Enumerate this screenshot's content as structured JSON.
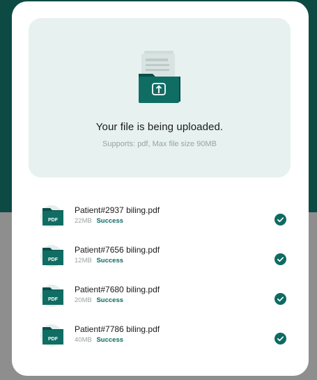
{
  "upload": {
    "title": "Your file is being uploaded.",
    "subtitle": "Supports: pdf, Max file size 90MB",
    "icon": "folder-upload-icon"
  },
  "files": [
    {
      "name": "Patient#2937 biling.pdf",
      "size": "22MB",
      "status": "Success",
      "badge": "PDF"
    },
    {
      "name": "Patient#7656 biling.pdf",
      "size": "12MB",
      "status": "Success",
      "badge": "PDF"
    },
    {
      "name": "Patient#7680 biling.pdf",
      "size": "20MB",
      "status": "Success",
      "badge": "PDF"
    },
    {
      "name": "Patient#7786 biling.pdf",
      "size": "40MB",
      "status": "Success",
      "badge": "PDF"
    }
  ],
  "colors": {
    "accent": "#0d6b62",
    "header_bg": "#0d4a44",
    "dropzone_bg": "#e6f1f0"
  }
}
